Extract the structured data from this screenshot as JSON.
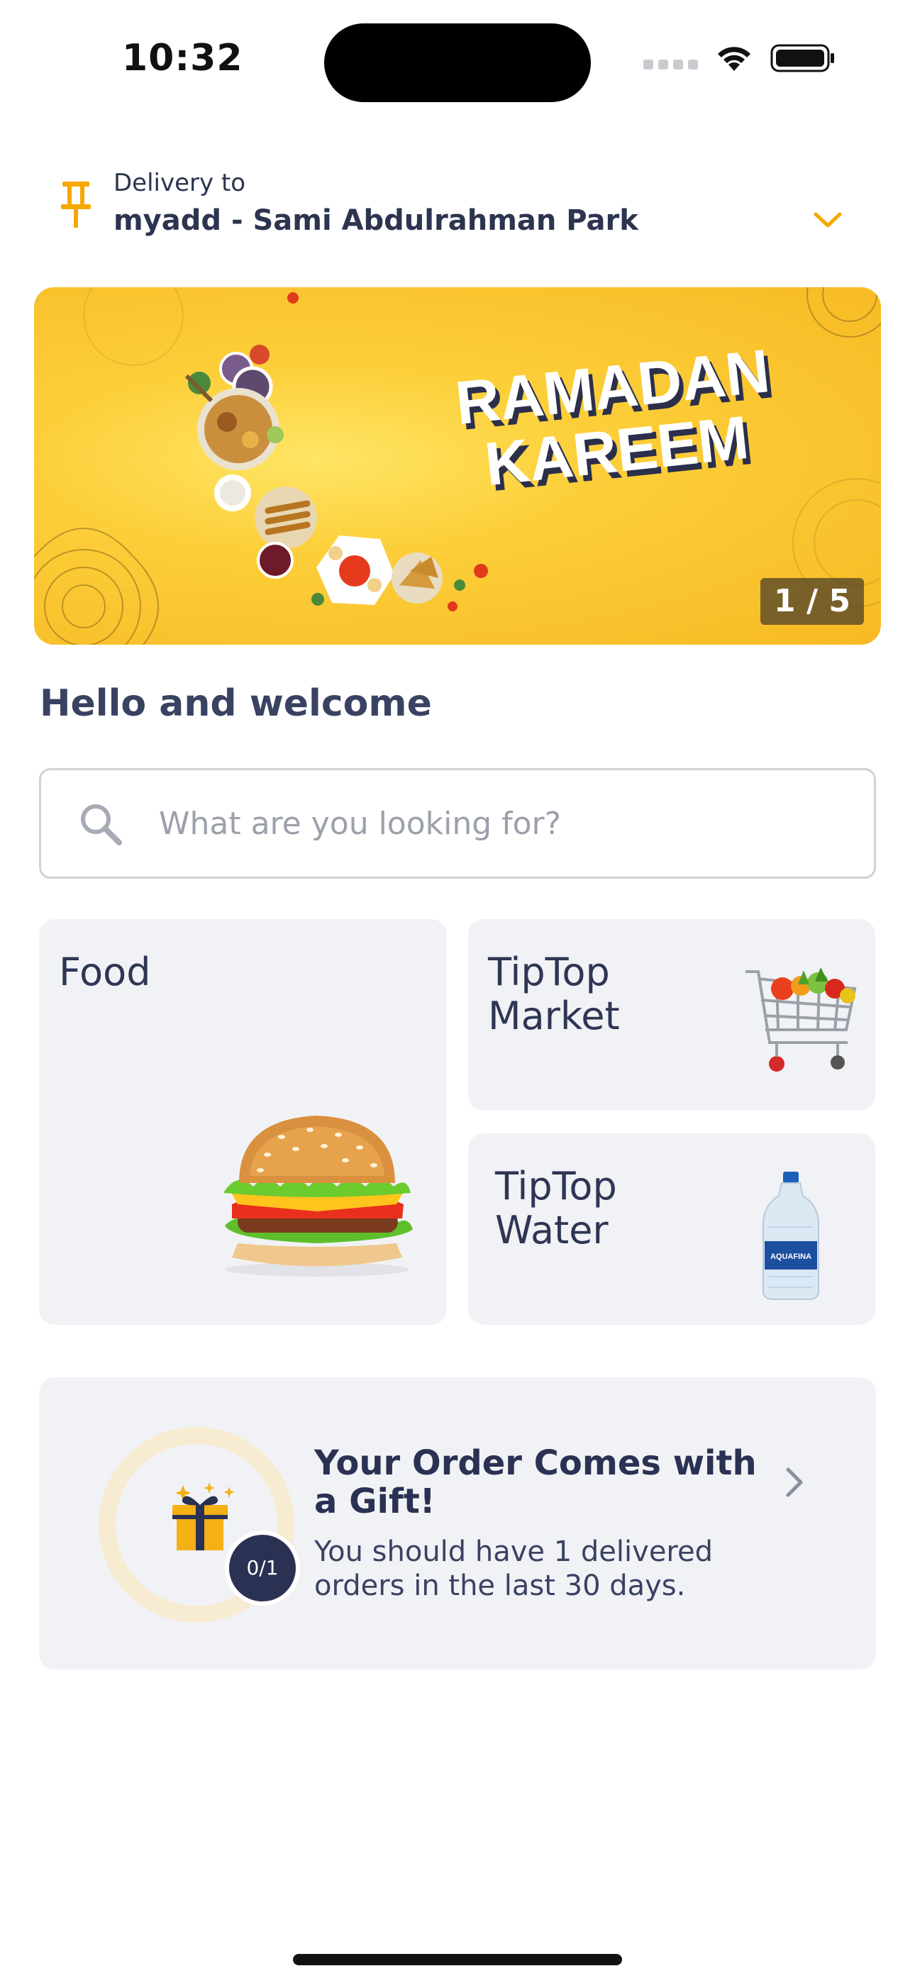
{
  "status_bar": {
    "time": "10:32"
  },
  "delivery": {
    "label": "Delivery to",
    "address": "myadd - Sami Abdulrahman Park"
  },
  "banner": {
    "headline_line1": "RAMADAN",
    "headline_line2": "KAREEM",
    "counter": "1 / 5",
    "current_slide": 1,
    "total_slides": 5
  },
  "greeting": "Hello and welcome",
  "search": {
    "placeholder": "What are you looking for?"
  },
  "categories": [
    {
      "title": "Food",
      "image": "burger"
    },
    {
      "title": "TipTop\nMarket",
      "image": "shopping-cart"
    },
    {
      "title": "TipTop\nWater",
      "image": "water-bottle"
    }
  ],
  "gift": {
    "title": "Your Order Comes with a Gift!",
    "description": "You should have 1 delivered orders in the last 30 days.",
    "progress": "0/1",
    "icon": "gift-icon"
  },
  "colors": {
    "accent": "#f5a800",
    "banner_yellow": "#fcc52f",
    "dark_navy": "#2b3152",
    "card_bg": "#f1f2f6"
  }
}
